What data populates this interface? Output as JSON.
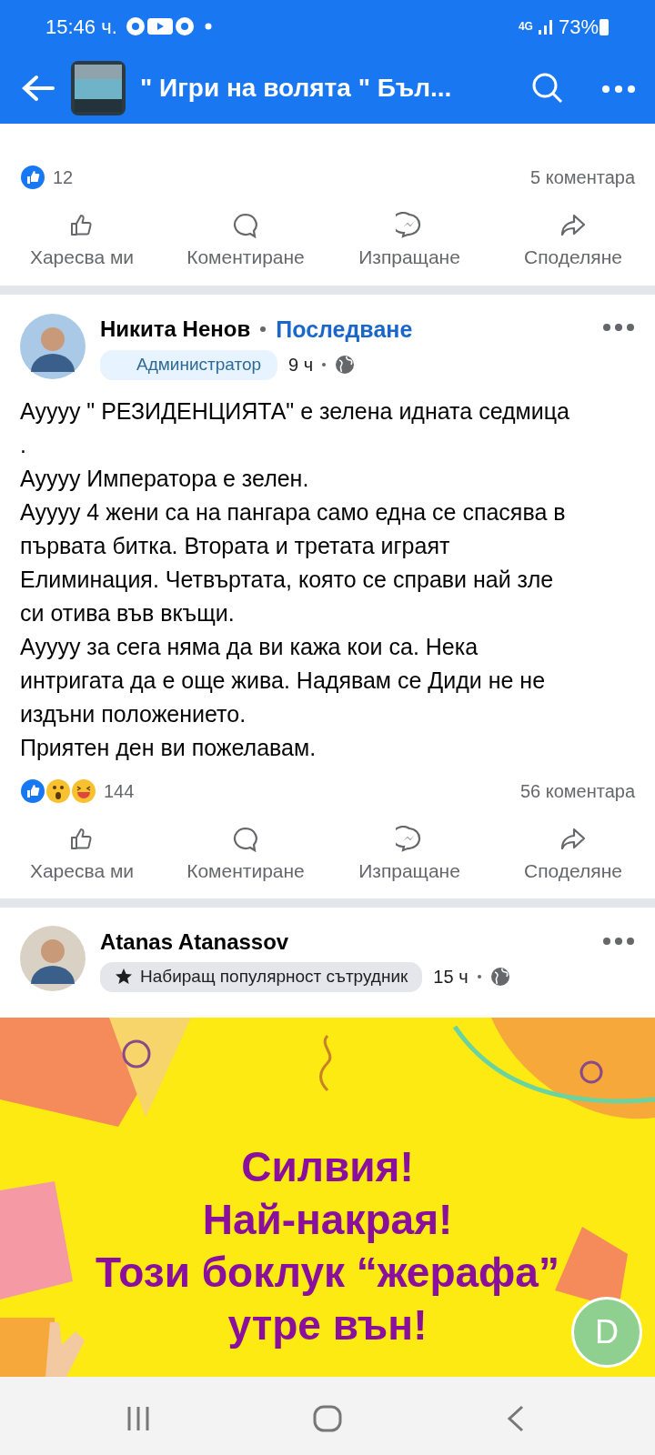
{
  "status_bar": {
    "time": "15:46 ч.",
    "network": "4G",
    "battery": "73%"
  },
  "header": {
    "title": "\" Игри на волята \" Бъл..."
  },
  "posts": [
    {
      "kind": "tail",
      "reactions": "12",
      "comments": "5 коментара",
      "actions": [
        "Харесва ми",
        "Коментиране",
        "Изпращане",
        "Споделяне"
      ]
    },
    {
      "kind": "text",
      "author": "Никита Ненов",
      "follow": "Последване",
      "badge": {
        "kind": "admin",
        "label": "Администратор"
      },
      "time": "9 ч",
      "paragraphs": [
        "Ауууу \" РЕЗИДЕНЦИЯТА\" е зелена идната седмица .",
        "Ауууу Императора е зелен.",
        "Ауууу 4 жени са на пангара само една се спасява в първата битка. Втората и третата играят Елиминация. Четвъртата, която се справи най зле си отива във вкъщи.",
        "Ауууу за сега няма да ви кажа кои са. Нека интригата да е още жива. Надявам се Диди не не издъни положението.",
        "Приятен ден ви пожелавам."
      ],
      "reactions": "144",
      "comments": "56 коментара",
      "actions": [
        "Харесва ми",
        "Коментиране",
        "Изпращане",
        "Споделяне"
      ]
    },
    {
      "author": "Atanas Atanassov",
      "badge": {
        "kind": "star",
        "label": "Набиращ популярност сътрудник"
      },
      "time": "15 ч",
      "image_lines": [
        "Силвия!",
        "Най-накрая!",
        "Този боклук “жерафа”",
        "утре вън!"
      ],
      "chat_head": "D"
    }
  ]
}
